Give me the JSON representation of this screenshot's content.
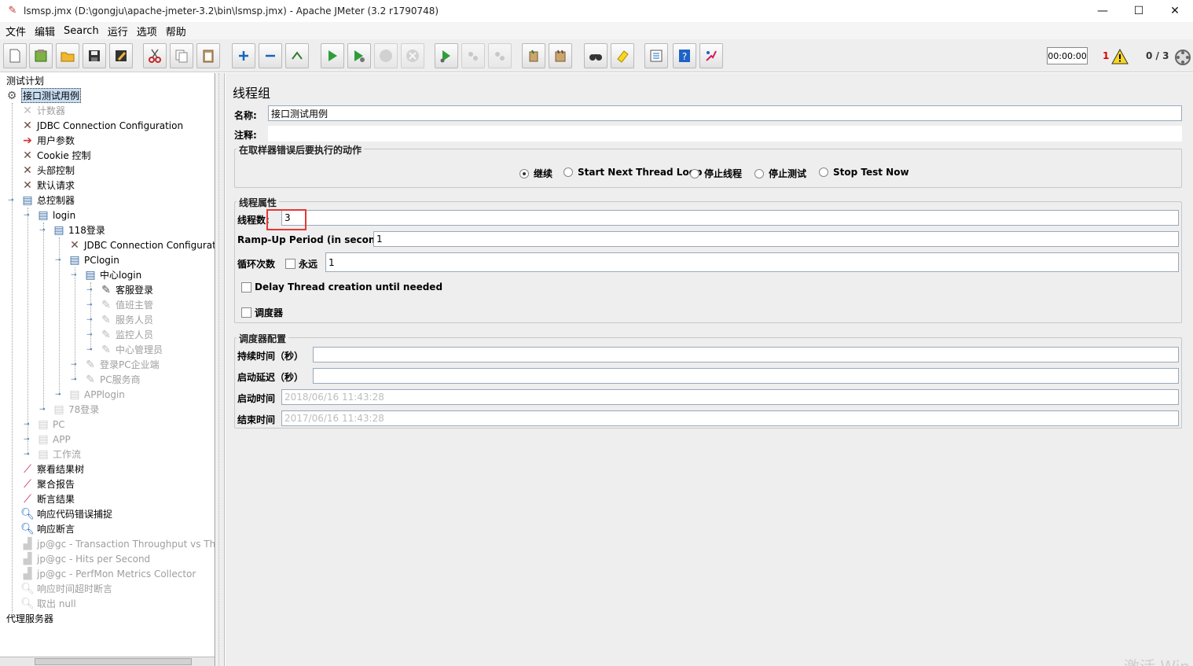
{
  "window": {
    "title": "lsmsp.jmx (D:\\gongju\\apache-jmeter-3.2\\bin\\lsmsp.jmx) - Apache JMeter (3.2 r1790748)",
    "minimize": "—",
    "maximize": "☐",
    "close": "✕"
  },
  "menu": [
    "文件",
    "编辑",
    "Search",
    "运行",
    "选项",
    "帮助"
  ],
  "status": {
    "timer": "00:00:00",
    "error_count": "1",
    "threads": "0 / 3"
  },
  "tree": {
    "nodes": [
      {
        "label": "测试计划",
        "icon": "none",
        "disabled": false
      },
      {
        "label": "接口测试用例",
        "icon": "gear-icon",
        "disabled": false,
        "selected": true
      },
      {
        "label": "计数器",
        "icon": "wrench-icon",
        "disabled": true
      },
      {
        "label": "JDBC Connection Configuration",
        "icon": "wrench-icon",
        "disabled": false
      },
      {
        "label": "用户参数",
        "icon": "preprocessor-icon",
        "disabled": false
      },
      {
        "label": "Cookie 控制",
        "icon": "wrench-icon",
        "disabled": false
      },
      {
        "label": "头部控制",
        "icon": "wrench-icon",
        "disabled": false
      },
      {
        "label": "默认请求",
        "icon": "wrench-icon",
        "disabled": false
      },
      {
        "label": "总控制器",
        "icon": "controller-icon",
        "disabled": false
      },
      {
        "label": "login",
        "icon": "controller-icon",
        "disabled": false
      },
      {
        "label": "118登录",
        "icon": "controller-icon",
        "disabled": false
      },
      {
        "label": "JDBC Connection Configuratio",
        "icon": "wrench-icon",
        "disabled": false
      },
      {
        "label": "PClogin",
        "icon": "controller-icon",
        "disabled": false
      },
      {
        "label": "中心login",
        "icon": "controller-icon",
        "disabled": false
      },
      {
        "label": "客服登录",
        "icon": "sampler-icon",
        "disabled": false
      },
      {
        "label": "值班主管",
        "icon": "sampler-icon",
        "disabled": true
      },
      {
        "label": "服务人员",
        "icon": "sampler-icon",
        "disabled": true
      },
      {
        "label": "监控人员",
        "icon": "sampler-icon",
        "disabled": true
      },
      {
        "label": "中心管理员",
        "icon": "sampler-icon",
        "disabled": true
      },
      {
        "label": "登录PC企业端",
        "icon": "sampler-icon",
        "disabled": true
      },
      {
        "label": "PC服务商",
        "icon": "sampler-icon",
        "disabled": true
      },
      {
        "label": "APPlogin",
        "icon": "controller-icon",
        "disabled": true
      },
      {
        "label": "78登录",
        "icon": "controller-icon",
        "disabled": true
      },
      {
        "label": "PC",
        "icon": "controller-icon",
        "disabled": true
      },
      {
        "label": "APP",
        "icon": "controller-icon",
        "disabled": true
      },
      {
        "label": "工作流",
        "icon": "controller-icon",
        "disabled": true
      },
      {
        "label": "察看结果树",
        "icon": "listener-icon",
        "disabled": false
      },
      {
        "label": "聚合报告",
        "icon": "listener-icon",
        "disabled": false
      },
      {
        "label": "断言结果",
        "icon": "listener-icon",
        "disabled": false
      },
      {
        "label": "响应代码错误捕捉",
        "icon": "magnifier-icon",
        "disabled": false
      },
      {
        "label": "响应断言",
        "icon": "magnifier-icon",
        "disabled": false
      },
      {
        "label": "jp@gc - Transaction Throughput vs Threa",
        "icon": "graph-icon",
        "disabled": true
      },
      {
        "label": "jp@gc - Hits per Second",
        "icon": "graph-icon",
        "disabled": true
      },
      {
        "label": "jp@gc - PerfMon Metrics Collector",
        "icon": "graph-icon",
        "disabled": true
      },
      {
        "label": "响应时间超时断言",
        "icon": "magnifier-icon",
        "disabled": true
      },
      {
        "label": "取出 null",
        "icon": "magnifier-icon",
        "disabled": true
      },
      {
        "label": "代理服务器",
        "icon": "none",
        "disabled": false
      }
    ]
  },
  "panel": {
    "title": "线程组",
    "name_label": "名称:",
    "name_value": "接口测试用例",
    "comment_label": "注释:",
    "comment_value": "",
    "error_group_title": "在取样器错误后要执行的动作",
    "error_actions": [
      {
        "label": "继续",
        "selected": true
      },
      {
        "label": "Start Next Thread Loop",
        "selected": false
      },
      {
        "label": "停止线程",
        "selected": false
      },
      {
        "label": "停止测试",
        "selected": false
      },
      {
        "label": "Stop Test Now",
        "selected": false
      }
    ],
    "thread_group_title": "线程属性",
    "threads_label": "线程数:",
    "threads_value": "3",
    "rampup_label": "Ramp-Up Period (in seconds):",
    "rampup_value": "1",
    "loop_label": "循环次数",
    "forever_label": "永远",
    "loop_value": "1",
    "delay_label": "Delay Thread creation until needed",
    "scheduler_label": "调度器",
    "scheduler_group_title": "调度器配置",
    "duration_label": "持续时间（秒）",
    "duration_value": "",
    "startup_delay_label": "启动延迟（秒）",
    "startup_delay_value": "",
    "start_time_label": "启动时间",
    "start_time_value": "2018/06/16 11:43:28",
    "end_time_label": "结束时间",
    "end_time_value": "2017/06/16 11:43:28"
  },
  "watermark": "激活 Win"
}
